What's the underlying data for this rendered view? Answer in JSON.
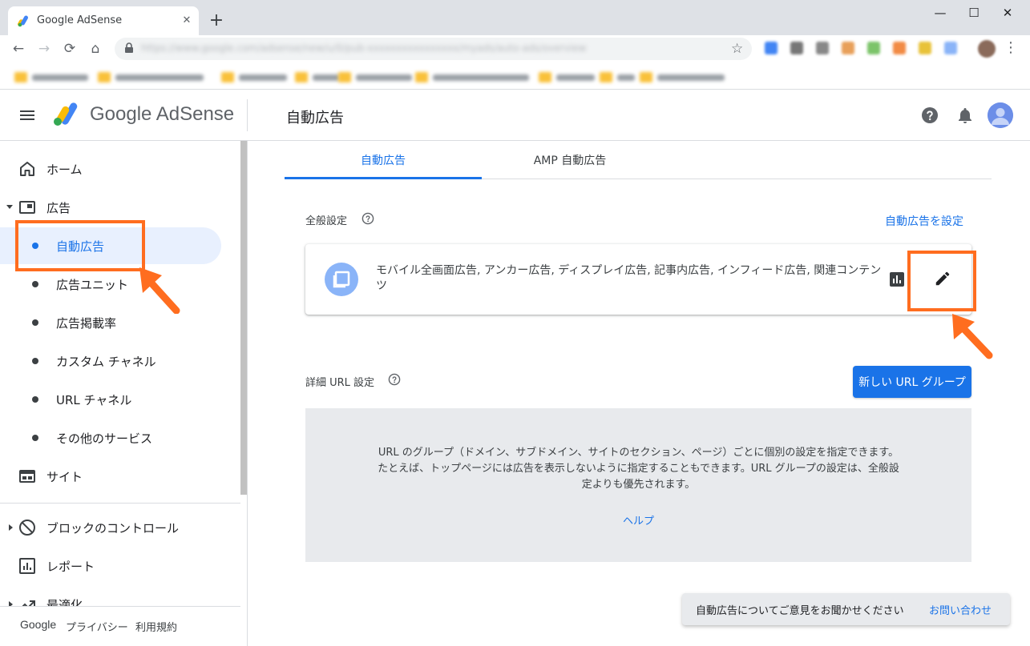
{
  "browser": {
    "tab_title": "Google AdSense",
    "tab_close": "✕",
    "new_tab": "+",
    "window_controls": {
      "minimize": "—",
      "maximize": "☐",
      "close": "✕"
    },
    "nav": {
      "back": "←",
      "forward": "→",
      "reload": "⟳",
      "home": "⌂"
    },
    "url": "https://www.google.com/adsense/new/u/0/pub-xxxxxxxxxxxxxxxx/myads/auto-ads/overview",
    "bookmark_star": "☆",
    "menu": "⋮"
  },
  "app": {
    "brand": "Google AdSense",
    "page_title": "自動広告",
    "icons": [
      "menu-icon",
      "help-icon",
      "notifications-icon",
      "account-icon"
    ]
  },
  "sidebar": {
    "items": [
      {
        "label": "ホーム",
        "icon": "home-icon"
      },
      {
        "label": "広告",
        "icon": "ads-icon",
        "expanded": true
      },
      {
        "label": "サイト",
        "icon": "sites-icon"
      },
      {
        "label": "ブロックのコントロール",
        "icon": "block-icon"
      },
      {
        "label": "レポート",
        "icon": "report-icon"
      },
      {
        "label": "最適化",
        "icon": "optimize-icon"
      }
    ],
    "ads_children": [
      {
        "label": "自動広告",
        "active": true
      },
      {
        "label": "広告ユニット"
      },
      {
        "label": "広告掲載率"
      },
      {
        "label": "カスタム チャネル"
      },
      {
        "label": "URL チャネル"
      },
      {
        "label": "その他のサービス"
      }
    ],
    "footer": {
      "google": "Google",
      "privacy": "プライバシー",
      "terms": "利用規約"
    }
  },
  "main": {
    "tabs": [
      {
        "label": "自動広告",
        "active": true
      },
      {
        "label": "AMP 自動広告"
      }
    ],
    "general": {
      "heading": "全般設定",
      "setup_link": "自動広告を設定",
      "card_text": "モバイル全画面広告, アンカー広告, ディスプレイ広告, 記事内広告, インフィード広告, 関連コンテンツ"
    },
    "url_settings": {
      "heading": "詳細 URL 設定",
      "new_group_button": "新しい URL グループ",
      "info": "URL のグループ（ドメイン、サブドメイン、サイトのセクション、ページ）ごとに個別の設定を指定できます。たとえば、トップページには広告を表示しないように指定することもできます。URL グループの設定は、全般設定よりも優先されます。",
      "help_link": "ヘルプ"
    },
    "feedback": {
      "text": "自動広告についてご意見をお聞かせください",
      "link": "お問い合わせ"
    }
  },
  "colors": {
    "accent": "#1a73e8",
    "annotation": "#ff6d1f",
    "active_bg": "#e8f0fe"
  }
}
